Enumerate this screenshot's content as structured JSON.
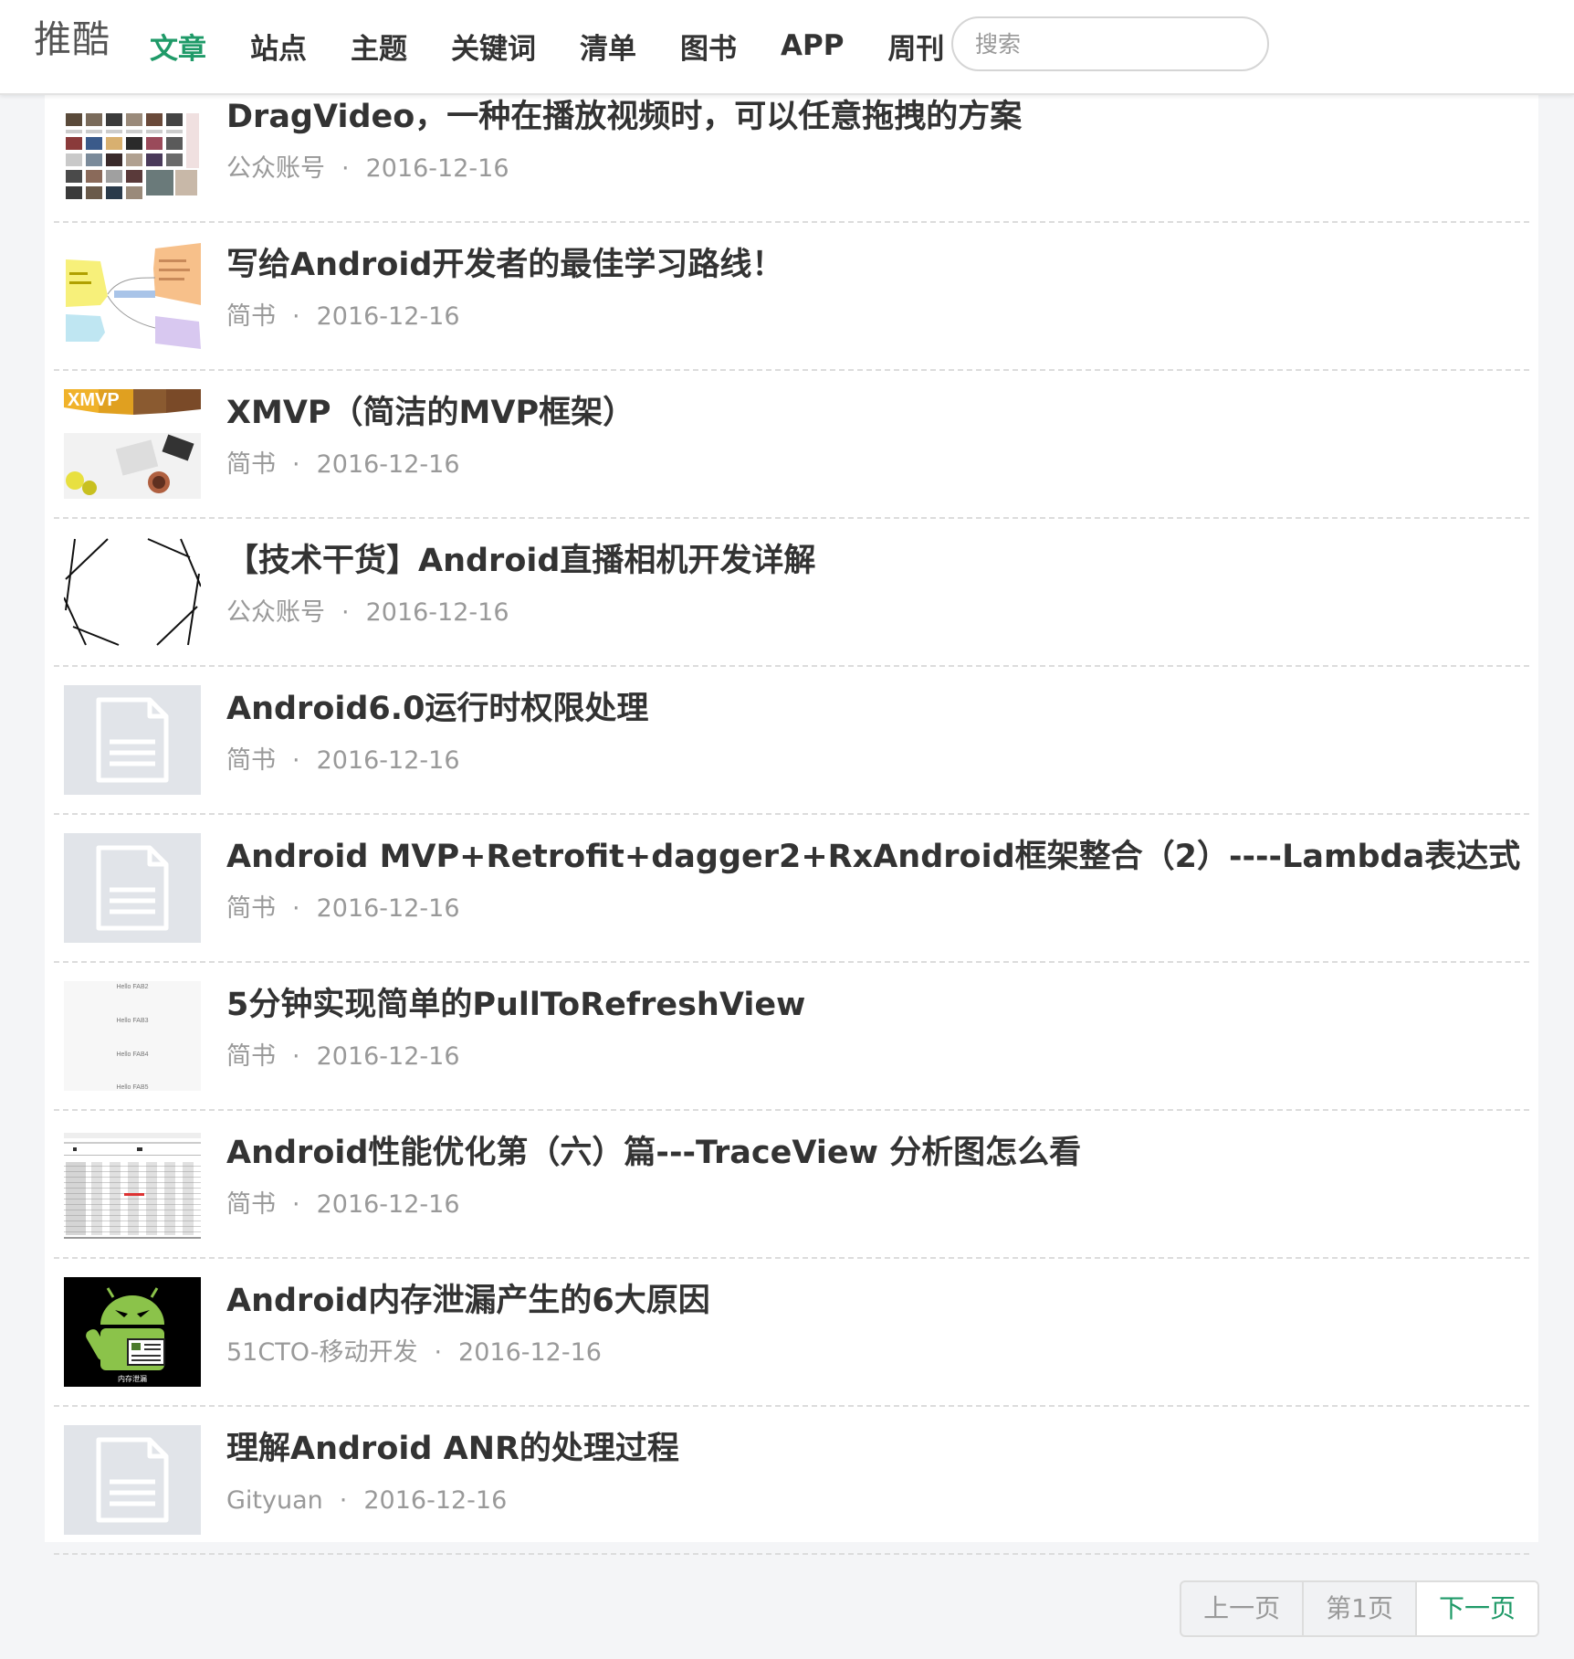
{
  "header": {
    "logo": "推酷",
    "nav": [
      {
        "label": "文章",
        "active": true
      },
      {
        "label": "站点"
      },
      {
        "label": "主题"
      },
      {
        "label": "关键词"
      },
      {
        "label": "清单"
      },
      {
        "label": "图书"
      },
      {
        "label": "APP"
      },
      {
        "label": "周刊",
        "dropdown": true
      }
    ],
    "search_placeholder": "搜索"
  },
  "articles": [
    {
      "title": "DragVideo，一种在播放视频时，可以任意拖拽的方案",
      "source": "公众账号",
      "date": "2016-12-16",
      "thumb": "video-grid"
    },
    {
      "title": "写给Android开发者的最佳学习路线！",
      "source": "简书",
      "date": "2016-12-16",
      "thumb": "mindmap"
    },
    {
      "title": "XMVP（简洁的MVP框架）",
      "source": "简书",
      "date": "2016-12-16",
      "thumb": "xmvp"
    },
    {
      "title": "【技术干货】Android直播相机开发详解",
      "source": "公众账号",
      "date": "2016-12-16",
      "thumb": "camera-aperture"
    },
    {
      "title": "Android6.0运行时权限处理",
      "source": "简书",
      "date": "2016-12-16",
      "thumb": "doc-placeholder"
    },
    {
      "title": "Android MVP+Retrofit+dagger2+RxAndroid框架整合（2）----Lambda表达式",
      "source": "简书",
      "date": "2016-12-16",
      "thumb": "doc-placeholder"
    },
    {
      "title": "5分钟实现简单的PullToRefreshView",
      "source": "简书",
      "date": "2016-12-16",
      "thumb": "hello-fab"
    },
    {
      "title": "Android性能优化第（六）篇---TraceView 分析图怎么看",
      "source": "简书",
      "date": "2016-12-16",
      "thumb": "traceview"
    },
    {
      "title": "Android内存泄漏产生的6大原因",
      "source": "51CTO-移动开发",
      "date": "2016-12-16",
      "thumb": "android-robot"
    },
    {
      "title": "理解Android ANR的处理过程",
      "source": "Gityuan",
      "date": "2016-12-16",
      "thumb": "doc-placeholder"
    }
  ],
  "thumb_text": {
    "xmvp": "XMVP",
    "hello_fab": [
      "Hello FAB2",
      "Hello FAB3",
      "Hello FAB4",
      "Hello FAB5"
    ],
    "android_robot": "内存泄漏"
  },
  "pager": {
    "prev": "上一页",
    "current": "第1页",
    "next": "下一页"
  },
  "colors": {
    "accent": "#1f9a68",
    "text": "#333333",
    "muted": "#999999"
  }
}
